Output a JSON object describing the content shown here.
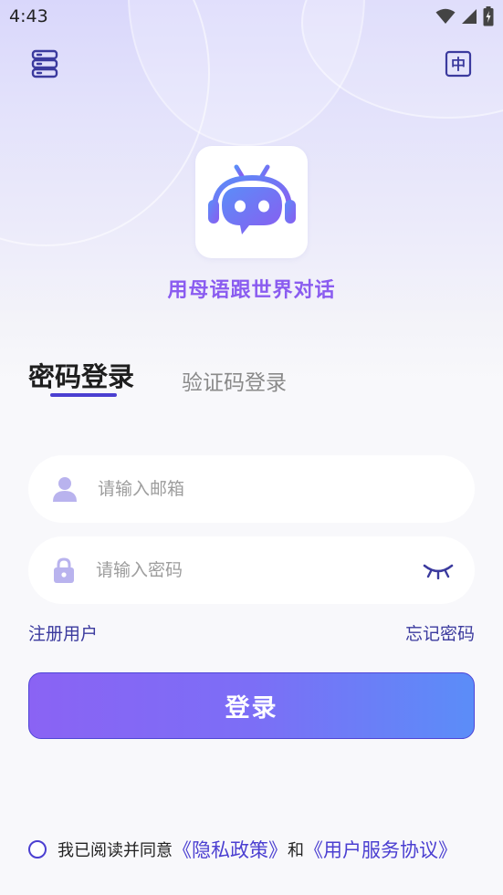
{
  "status_bar": {
    "time": "4:43",
    "icons": [
      "wifi-icon",
      "signal-icon",
      "battery-icon"
    ]
  },
  "header": {
    "left_icon": "server-icon",
    "right_icon": "language-icon",
    "language_label": "中"
  },
  "logo": {
    "icon": "robot-headphones-icon",
    "slogan": "用母语跟世界对话"
  },
  "tabs": [
    {
      "label": "密码登录",
      "active": true
    },
    {
      "label": "验证码登录",
      "active": false
    }
  ],
  "form": {
    "email_placeholder": "请输入邮箱",
    "email_value": "",
    "password_placeholder": "请输入密码",
    "password_value": "",
    "register_label": "注册用户",
    "forgot_label": "忘记密码",
    "login_label": "登录"
  },
  "agreement": {
    "prefix": "我已阅读并同意",
    "privacy_link": "《隐私政策》",
    "and": "和",
    "terms_link": "《用户服务协议》",
    "checked": false
  },
  "colors": {
    "accent": "#4b3fd1",
    "slogan": "#8a5cf0",
    "button_start": "#8a63f4",
    "button_end": "#5b8df8"
  }
}
